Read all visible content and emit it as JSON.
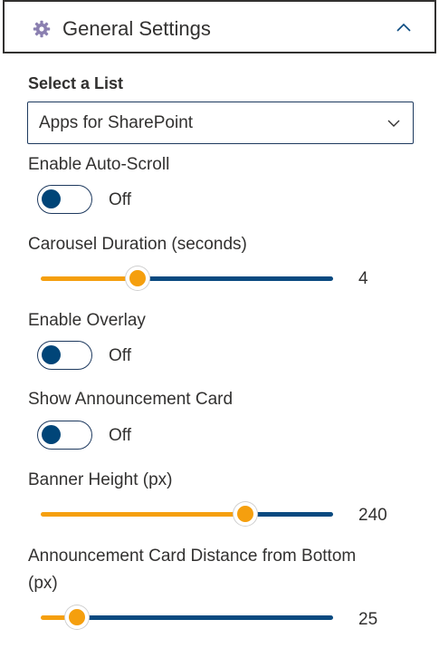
{
  "header": {
    "title": "General Settings",
    "icon": "gear-icon",
    "toggle_icon": "chevron-up-icon"
  },
  "select_list": {
    "label": "Select a List",
    "value": "Apps for SharePoint",
    "icon": "chevron-down-icon"
  },
  "auto_scroll": {
    "label": "Enable Auto-Scroll",
    "state": "Off"
  },
  "carousel_duration": {
    "label": "Carousel Duration (seconds)",
    "value": "4",
    "fill_fraction": 0.33
  },
  "overlay": {
    "label": "Enable Overlay",
    "state": "Off"
  },
  "announcement_card": {
    "label": "Show Announcement Card",
    "state": "Off"
  },
  "banner_height": {
    "label": "Banner Height (px)",
    "value": "240",
    "fill_fraction": 0.7
  },
  "card_distance": {
    "label_line1": "Announcement Card Distance from Bottom",
    "label_line2": "(px)",
    "value": "25",
    "fill_fraction": 0.125
  },
  "colors": {
    "accent_orange": "#f59f0e",
    "accent_blue": "#0a4a80",
    "text": "#323130"
  }
}
